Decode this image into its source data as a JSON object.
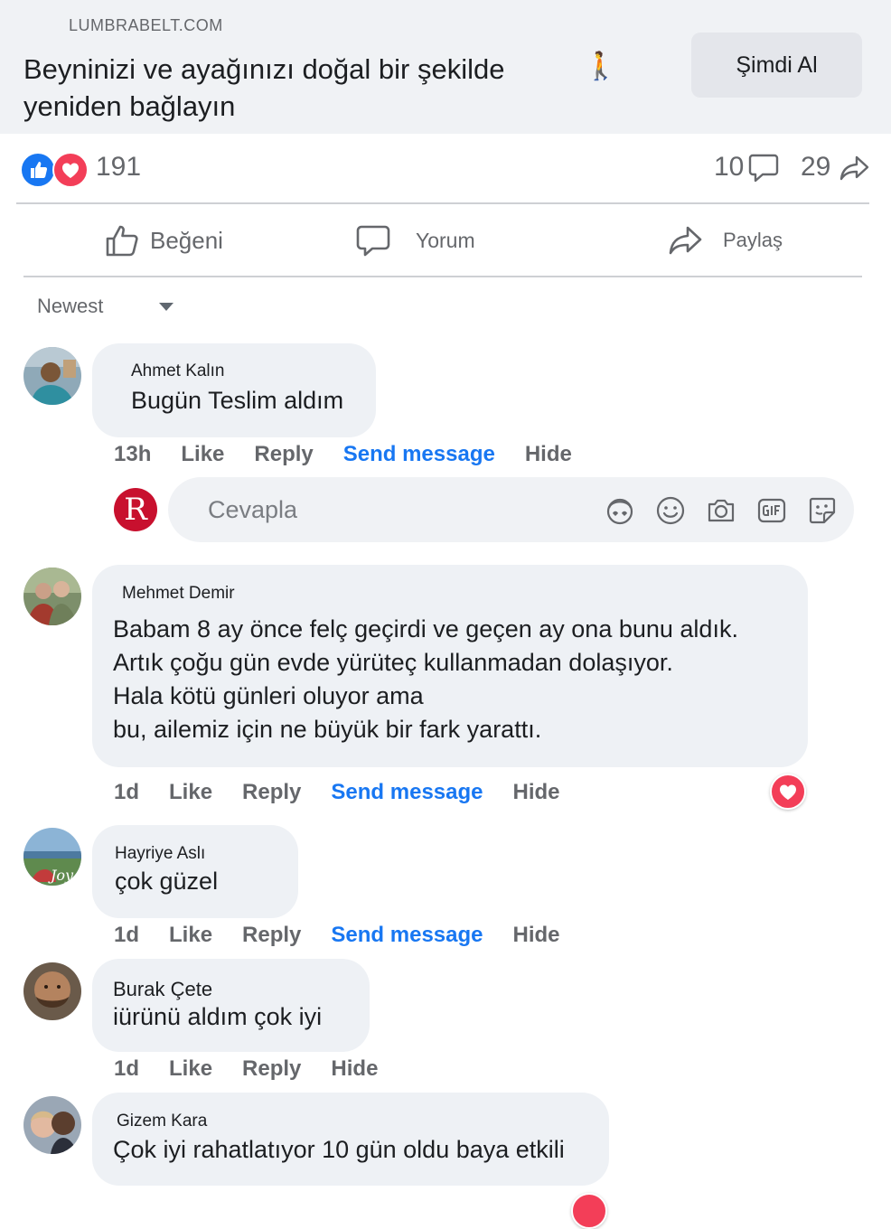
{
  "ad": {
    "domain": "LUMBRABELT.COM",
    "headline": "Beyninizi ve ayağınızı doğal bir şekilde yeniden bağlayın",
    "emoji": "🚶",
    "cta_label": "Şimdi Al"
  },
  "stats": {
    "reaction_count": "191",
    "comment_count": "10",
    "share_count": "29",
    "icons": [
      "like-reaction-icon",
      "love-reaction-icon",
      "comment-icon",
      "share-icon"
    ]
  },
  "actions": {
    "like_label": "Beğeni",
    "comment_label": "Yorum",
    "share_label": "Paylaş"
  },
  "sort": {
    "label": "Newest"
  },
  "reply_box": {
    "placeholder": "Cevapla",
    "avatar_letter": "R",
    "icons": [
      "avatar-sticker-icon",
      "emoji-icon",
      "camera-icon",
      "gif-icon",
      "sticker-icon"
    ]
  },
  "comments": [
    {
      "author": "Ahmet Kalın",
      "text": "Bugün Teslim aldım",
      "time": "13h",
      "like": "Like",
      "reply": "Reply",
      "send": "Send message",
      "hide": "Hide"
    },
    {
      "author": "Mehmet Demir",
      "text_lines": [
        "Babam 8 ay önce felç geçirdi ve geçen ay ona bunu aldık.",
        "Artık çoğu gün evde yürüteç kullanmadan dolaşıyor.",
        "Hala kötü günleri oluyor ama",
        "bu, ailemiz için ne büyük bir fark yarattı."
      ],
      "time": "1d",
      "like": "Like",
      "reply": "Reply",
      "send": "Send message",
      "hide": "Hide"
    },
    {
      "author": "Hayriye Aslı",
      "text": "çok güzel",
      "time": "1d",
      "like": "Like",
      "reply": "Reply",
      "send": "Send message",
      "hide": "Hide"
    },
    {
      "author": "Burak Çete",
      "text": "iürünü aldım çok iyi",
      "time": "1d",
      "like": "Like",
      "reply": "Reply",
      "hide": "Hide"
    },
    {
      "author": "Gizem Kara",
      "text": "Çok iyi rahatlatıyor 10 gün oldu baya etkili"
    }
  ]
}
